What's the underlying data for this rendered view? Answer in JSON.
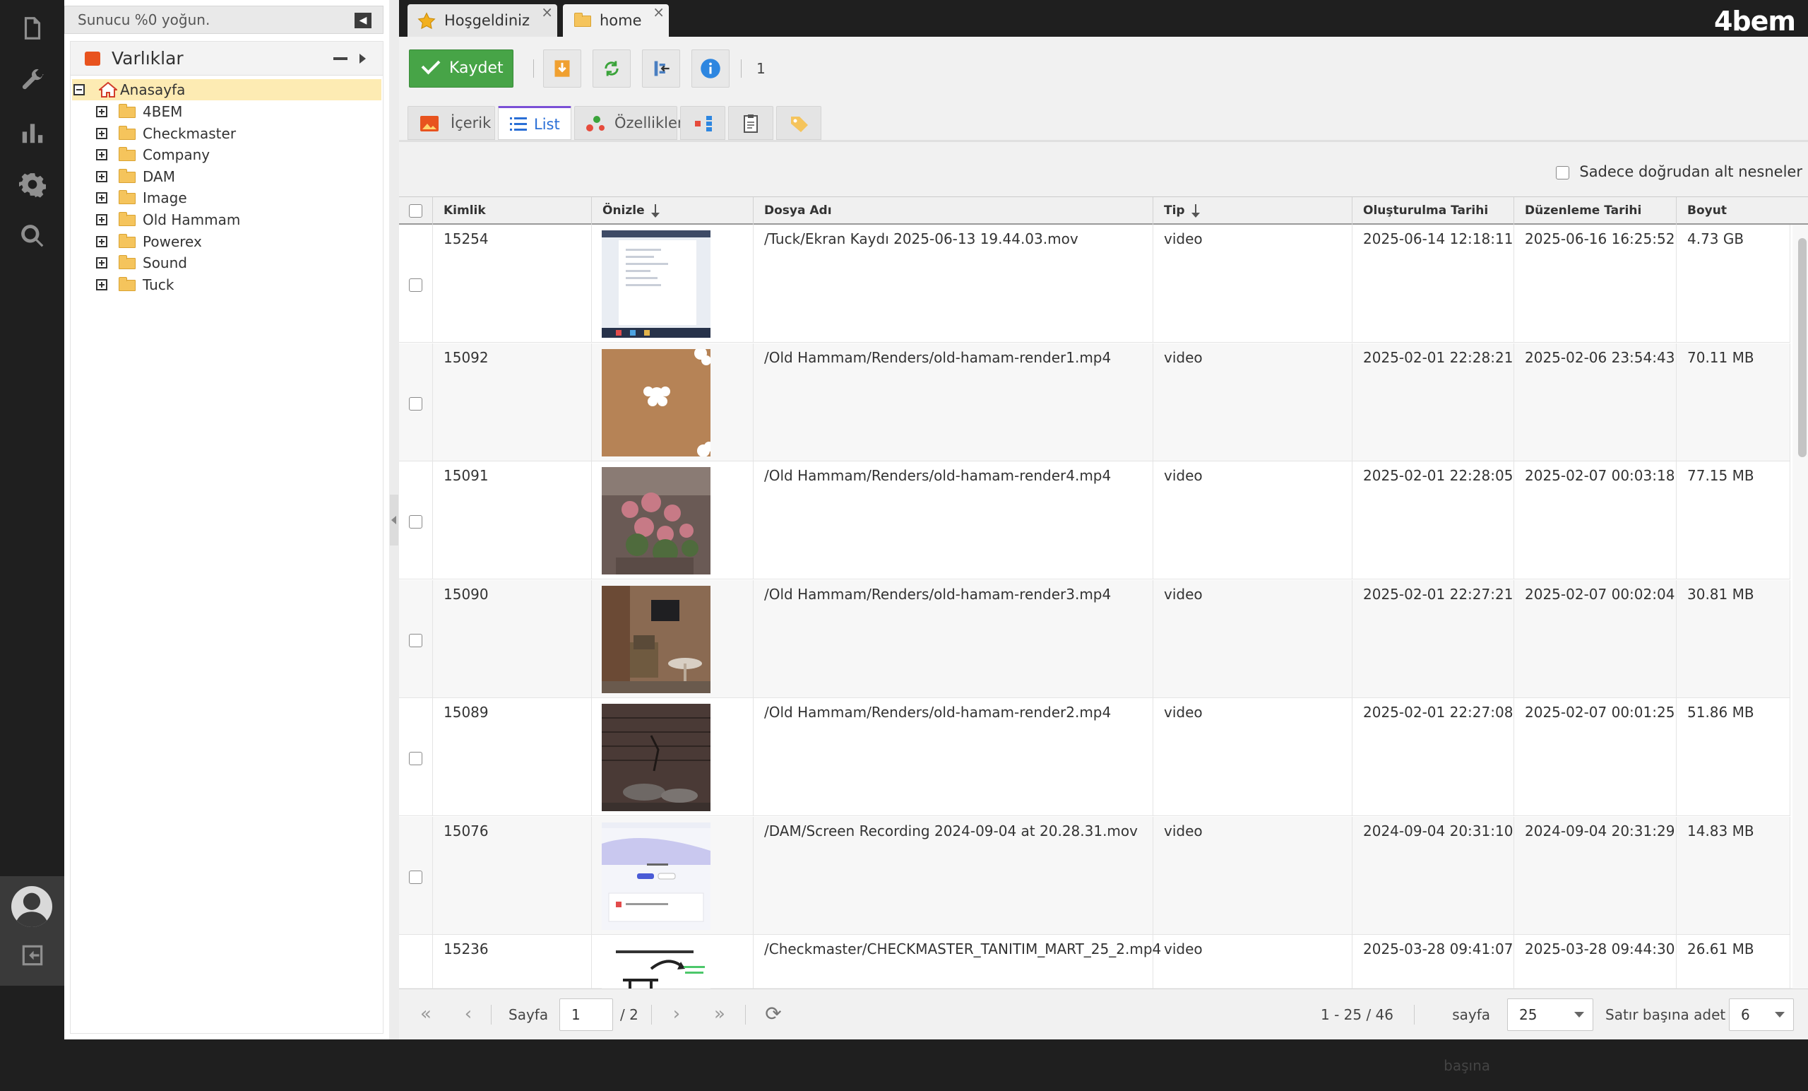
{
  "iconbar": {
    "icons": [
      "document-icon",
      "wrench-icon",
      "bar-chart-icon",
      "gear-icon",
      "search-icon",
      "user-avatar-icon",
      "logout-icon"
    ]
  },
  "tree": {
    "status_text": "Sunucu %0 yoğun.",
    "panel_title": "Varlıklar",
    "root_label": "Anasayfa",
    "items": [
      {
        "label": "4BEM"
      },
      {
        "label": "Checkmaster"
      },
      {
        "label": "Company"
      },
      {
        "label": "DAM"
      },
      {
        "label": "Image"
      },
      {
        "label": "Old Hammam"
      },
      {
        "label": "Powerex"
      },
      {
        "label": "Sound"
      },
      {
        "label": "Tuck"
      }
    ]
  },
  "doc_tabs": [
    {
      "label": "Hoşgeldiniz",
      "icon": "star-icon"
    },
    {
      "label": "home",
      "icon": "folder-icon"
    }
  ],
  "brand": "4bem",
  "toolbar": {
    "save_label": "Kaydet",
    "selection_count": "1"
  },
  "sub_tabs": [
    {
      "label": "İçerik",
      "icon": "image-icon"
    },
    {
      "label": "List",
      "icon": "list-icon"
    },
    {
      "label": "Özellikler",
      "icon": "properties-icon"
    },
    {
      "label": "",
      "icon": "dependencies-icon"
    },
    {
      "label": "",
      "icon": "notes-icon"
    },
    {
      "label": "",
      "icon": "tag-icon"
    }
  ],
  "filter": {
    "direct_children_label": "Sadece doğrudan alt nesneler"
  },
  "grid": {
    "columns": [
      "Kimlik",
      "Önizle",
      "Dosya Adı",
      "Tip",
      "Oluşturulma Tarihi",
      "Düzenleme Tarihi",
      "Boyut"
    ],
    "rows": [
      {
        "id": "15254",
        "filename": "/Tuck/Ekran Kaydı 2025-06-13 19.44.03.mov",
        "type": "video",
        "created": "2025-06-14 12:18:11",
        "modified": "2025-06-16 16:25:52",
        "size": "4.73 GB",
        "thumb": "screen-recording"
      },
      {
        "id": "15092",
        "filename": "/Old Hammam/Renders/old-hamam-render1.mp4",
        "type": "video",
        "created": "2025-02-01 22:28:21",
        "modified": "2025-02-06 23:54:43",
        "size": "70.11 MB",
        "thumb": "ceiling-flowers"
      },
      {
        "id": "15091",
        "filename": "/Old Hammam/Renders/old-hamam-render4.mp4",
        "type": "video",
        "created": "2025-02-01 22:28:05",
        "modified": "2025-02-07 00:03:18",
        "size": "77.15 MB",
        "thumb": "pink-flowers"
      },
      {
        "id": "15090",
        "filename": "/Old Hammam/Renders/old-hamam-render3.mp4",
        "type": "video",
        "created": "2025-02-01 22:27:21",
        "modified": "2025-02-07 00:02:04",
        "size": "30.81 MB",
        "thumb": "room-chair"
      },
      {
        "id": "15089",
        "filename": "/Old Hammam/Renders/old-hamam-render2.mp4",
        "type": "video",
        "created": "2025-02-01 22:27:08",
        "modified": "2025-02-07 00:01:25",
        "size": "51.86 MB",
        "thumb": "brick-wall"
      },
      {
        "id": "15076",
        "filename": "/DAM/Screen Recording 2024-09-04 at 20.28.31.mov",
        "type": "video",
        "created": "2024-09-04 20:31:10",
        "modified": "2024-09-04 20:31:29",
        "size": "14.83 MB",
        "thumb": "web-page"
      },
      {
        "id": "15236",
        "filename": "/Checkmaster/CHECKMASTER_TANITIM_MART_25_2.mp4",
        "type": "video",
        "created": "2025-03-28 09:41:07",
        "modified": "2025-03-28 09:44:30",
        "size": "26.61 MB",
        "thumb": "promo"
      }
    ]
  },
  "pager": {
    "page_label": "Sayfa",
    "current_page": "1",
    "total_pages": "/ 2",
    "range_text": "1 - 25 / 46",
    "per_page_label": "sayfa başına",
    "per_page_value": "25",
    "per_row_label": "Satır başına adet",
    "per_row_value": "6"
  },
  "colors": {
    "save_green": "#47a447",
    "active_tab_accent": "#7a4fd6",
    "tree_selected": "#fdebb3",
    "sidebar_bg": "#1f1f1f"
  }
}
